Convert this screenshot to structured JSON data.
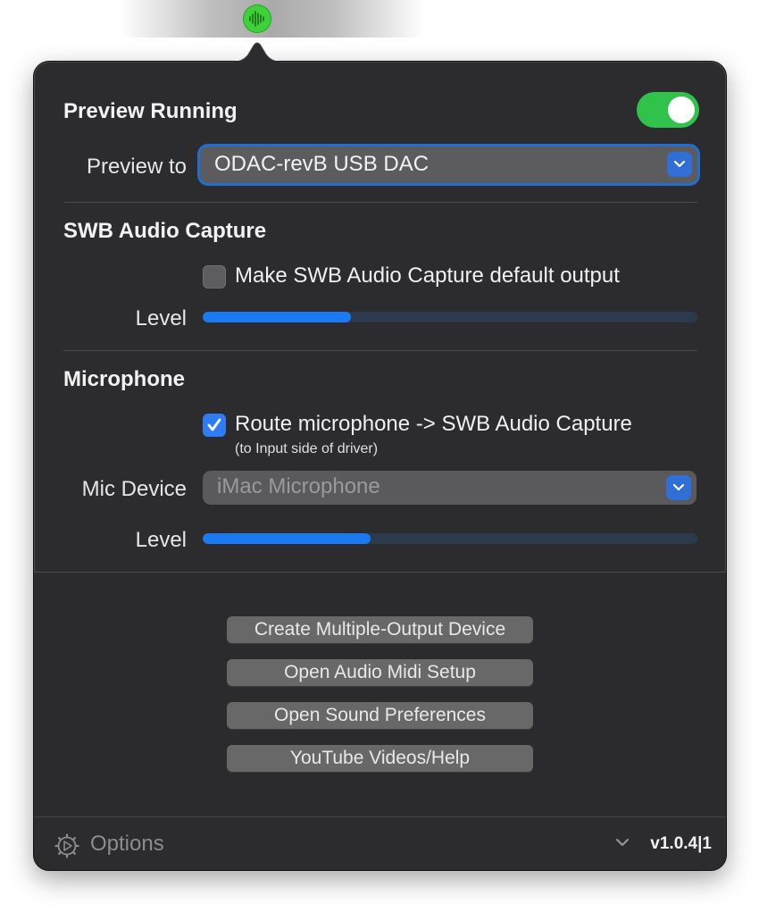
{
  "menubar": {
    "icon": "waveform-icon"
  },
  "preview": {
    "title": "Preview Running",
    "toggle_on": true,
    "to_label": "Preview to",
    "device_value": "ODAC-revB USB DAC"
  },
  "swb": {
    "title": "SWB Audio Capture",
    "default_output_label": "Make SWB Audio Capture default output",
    "default_output_checked": false,
    "level_label": "Level",
    "level_fraction": 0.3
  },
  "mic": {
    "title": "Microphone",
    "route_label": "Route microphone -> SWB Audio Capture",
    "route_checked": true,
    "route_note": "(to Input side of driver)",
    "device_label": "Mic Device",
    "device_value": "iMac Microphone",
    "level_label": "Level",
    "level_fraction": 0.34
  },
  "buttons": {
    "multi_output": "Create Multiple-Output Device",
    "audio_midi": "Open Audio Midi Setup",
    "sound_prefs": "Open Sound Preferences",
    "youtube_help": "YouTube Videos/Help"
  },
  "footer": {
    "options_label": "Options",
    "version": "v1.0.4|1"
  },
  "colors": {
    "accent": "#1a7af1",
    "toggle_on": "#30c24b",
    "panel": "#2c2c2e"
  }
}
